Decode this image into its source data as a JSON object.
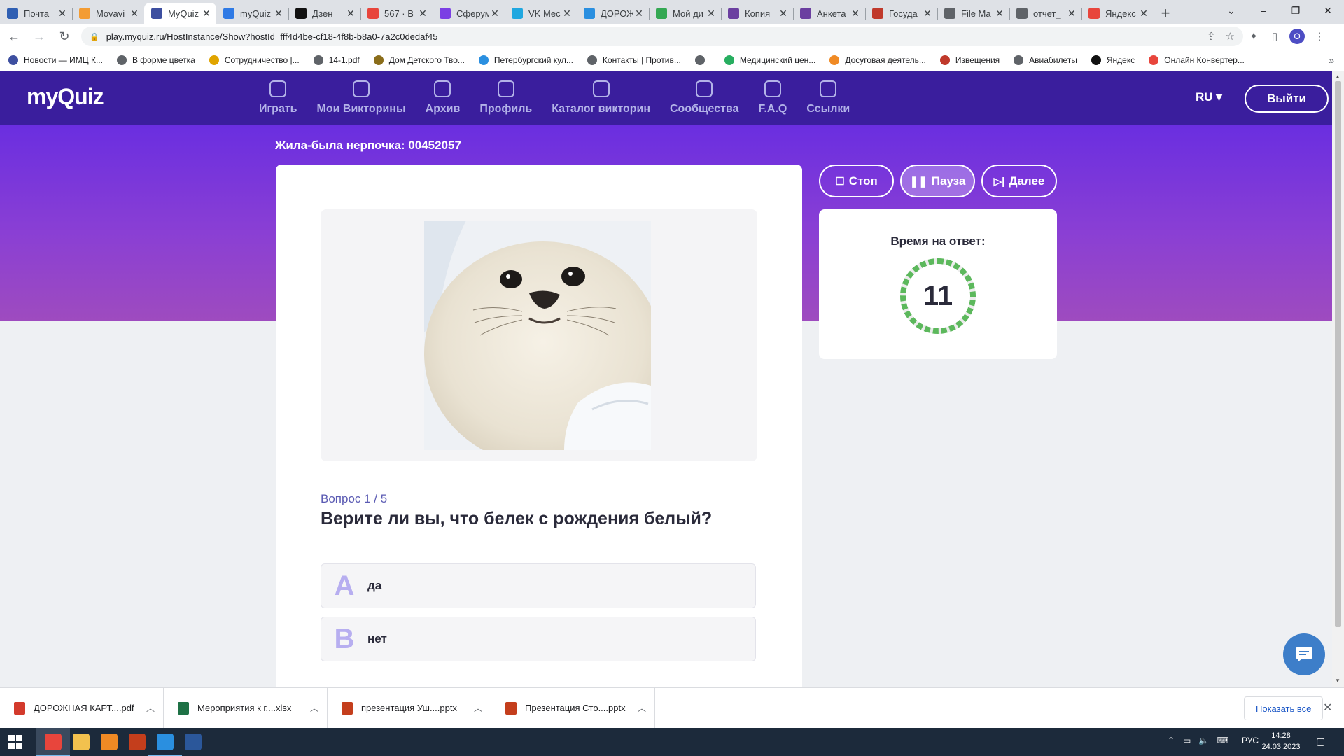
{
  "browser": {
    "tabs": [
      {
        "label": "Почта",
        "color": "#2f5fb3"
      },
      {
        "label": "Movavi",
        "color": "#f39c33"
      },
      {
        "label": "MyQuiz",
        "color": "#3d4fa0",
        "active": true
      },
      {
        "label": "myQuiz",
        "color": "#2f7ae5"
      },
      {
        "label": "Дзен",
        "color": "#111111"
      },
      {
        "label": "567 · В",
        "color": "#e8453c"
      },
      {
        "label": "Сферум",
        "color": "#7b3fe4"
      },
      {
        "label": "VK Мес",
        "color": "#1fa7e0"
      },
      {
        "label": "ДОРОЖ",
        "color": "#2a8fe0"
      },
      {
        "label": "Мой ди",
        "color": "#34a853"
      },
      {
        "label": "Копия",
        "color": "#6b3fa0"
      },
      {
        "label": "Анкета",
        "color": "#6b3fa0"
      },
      {
        "label": "Госуда",
        "color": "#c0392b"
      },
      {
        "label": "File Ma",
        "color": "#5f6368"
      },
      {
        "label": "отчет_",
        "color": "#5f6368"
      },
      {
        "label": "Яндекс",
        "color": "#e8453c"
      }
    ],
    "new_tab": "+",
    "window_controls": {
      "expand": "⌄",
      "minimize": "–",
      "restore": "❐",
      "close": "✕"
    },
    "url": "play.myquiz.ru/HostInstance/Show?hostId=fff4d4be-cf18-4f8b-b8a0-7a2c0dedaf45",
    "profile_initial": "О",
    "bookmarks": [
      {
        "label": "Новости — ИМЦ К...",
        "color": "#3d4fa0"
      },
      {
        "label": "В форме цветка",
        "color": "#5f6368"
      },
      {
        "label": "Сотрудничество |...",
        "color": "#e0a400"
      },
      {
        "label": "14-1.pdf",
        "color": "#5f6368"
      },
      {
        "label": "Дом Детского Тво...",
        "color": "#8a6d1a"
      },
      {
        "label": "Петербургский кул...",
        "color": "#2a8fe0"
      },
      {
        "label": "Контакты | Против...",
        "color": "#5f6368"
      },
      {
        "label": "",
        "color": "#5f6368"
      },
      {
        "label": "Медицинский цен...",
        "color": "#27ae60"
      },
      {
        "label": "Досуговая деятель...",
        "color": "#f08a24"
      },
      {
        "label": "Извещения",
        "color": "#c0392b"
      },
      {
        "label": "Авиабилеты",
        "color": "#5f6368"
      },
      {
        "label": "Яндекс",
        "color": "#111111"
      },
      {
        "label": "Онлайн Конвертер...",
        "color": "#e8453c"
      }
    ],
    "bookmarks_more": "»"
  },
  "site": {
    "logo": "myQuiz",
    "nav": [
      "Играть",
      "Мои Викторины",
      "Архив",
      "Профиль",
      "Каталог викторин",
      "Сообщества",
      "F.A.Q",
      "Ссылки"
    ],
    "lang": "RU",
    "logout": "Выйти"
  },
  "quiz": {
    "title": "Жила-была нерпочка: 00452057",
    "question_number": "Вопрос 1 / 5",
    "question": "Верите ли вы, что белек с рождения белый?",
    "answers": [
      {
        "letter": "A",
        "text": "да"
      },
      {
        "letter": "B",
        "text": "нет"
      }
    ]
  },
  "controls": {
    "stop": "Стоп",
    "pause": "Пауза",
    "next": "Далее"
  },
  "timer": {
    "label": "Время на ответ:",
    "value": "11",
    "color": "#5cb85c"
  },
  "downloads": {
    "items": [
      {
        "name": "ДОРОЖНАЯ КАРТ....pdf",
        "color": "#d33a2c"
      },
      {
        "name": "Мероприятия к г....xlsx",
        "color": "#1e7145"
      },
      {
        "name": "презентация Уш....pptx",
        "color": "#c43e1c"
      },
      {
        "name": "Презентация Сто....pptx",
        "color": "#c43e1c"
      }
    ],
    "show_all": "Показать все"
  },
  "taskbar": {
    "apps": [
      {
        "name": "chrome",
        "color": "#e8453c"
      },
      {
        "name": "explorer",
        "color": "#f2c14e"
      },
      {
        "name": "app-orange",
        "color": "#f08a24"
      },
      {
        "name": "powerpoint",
        "color": "#c43e1c"
      },
      {
        "name": "movavi",
        "color": "#2a8fe0"
      },
      {
        "name": "word",
        "color": "#2b579a"
      }
    ],
    "lang": "РУС",
    "time": "14:28",
    "date": "24.03.2023"
  }
}
